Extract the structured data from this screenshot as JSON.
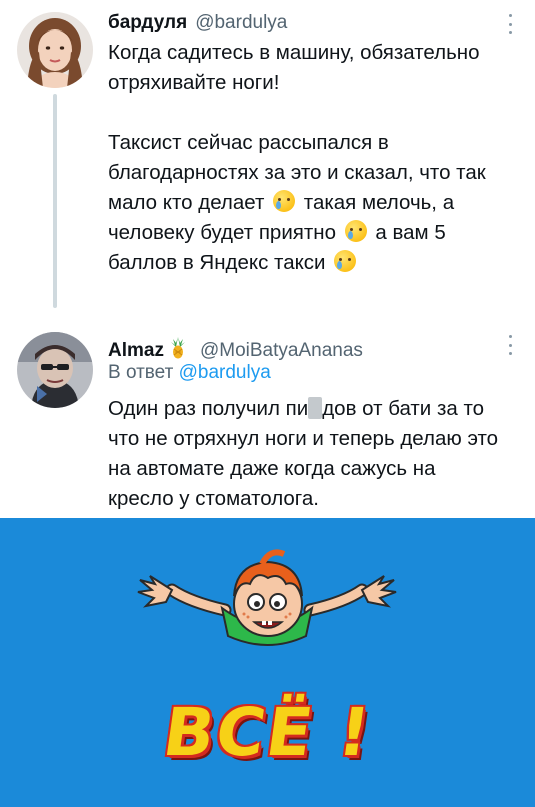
{
  "tweet1": {
    "display_name": "бардуля",
    "handle": "@bardulya",
    "lines": [
      "Когда садитесь в машину, обязательно",
      "отряхивайте ноги!",
      "",
      "Таксист сейчас рассыпался в",
      "благодарностях за это и сказал, что так"
    ],
    "line6_a": "мало кто делает",
    "line6_b": " такая мелочь, а",
    "line7_a": "человеку будет приятно",
    "line7_b": " а вам 5",
    "line8_a": "баллов в Яндекс такси",
    "emoji": "crying-face-emoji"
  },
  "tweet2": {
    "display_name": "Almaz",
    "name_emoji": "pineapple-emoji",
    "handle": "@MoiBatyaAnanas",
    "reply_prefix": "В ответ",
    "reply_mention": "@bardulya",
    "line1_a": "Один раз получил пи",
    "line1_b": "дов от бати за то",
    "lines": [
      "что не отряхнул ноги и теперь делаю это",
      "на автомате даже когда сажусь на",
      "кресло у стоматолога."
    ]
  },
  "image": {
    "caption": "ВСЁ !",
    "background_color": "#1b8ad9",
    "accent_colors": {
      "letters": "#f7d117",
      "outline": "#d42a1f",
      "hair": "#e8601c",
      "shirt": "#2db84a"
    }
  }
}
